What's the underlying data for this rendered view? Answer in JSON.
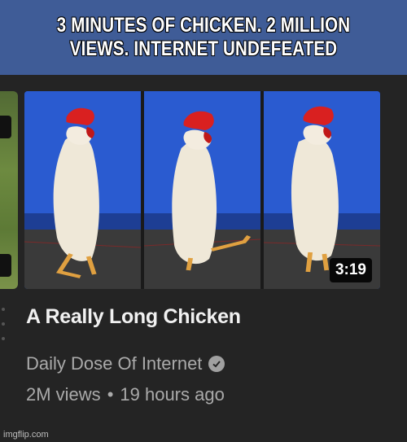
{
  "caption": {
    "text": "3 MINUTES OF CHICKEN. 2 MILLION VIEWS. INTERNET UNDEFEATED",
    "background": "#3f5c97"
  },
  "video": {
    "title": "A Really Long Chicken",
    "channel": "Daily Dose Of Internet",
    "views": "2M views",
    "separator": "•",
    "age": "19 hours ago",
    "duration": "3:19",
    "verified_icon": "verified-check-icon"
  },
  "watermark": "imgflip.com",
  "colors": {
    "background": "#232323",
    "title_text": "#f1f1f1",
    "meta_text": "#aaaaaa",
    "thumbnail_blue": "#2856c8"
  }
}
